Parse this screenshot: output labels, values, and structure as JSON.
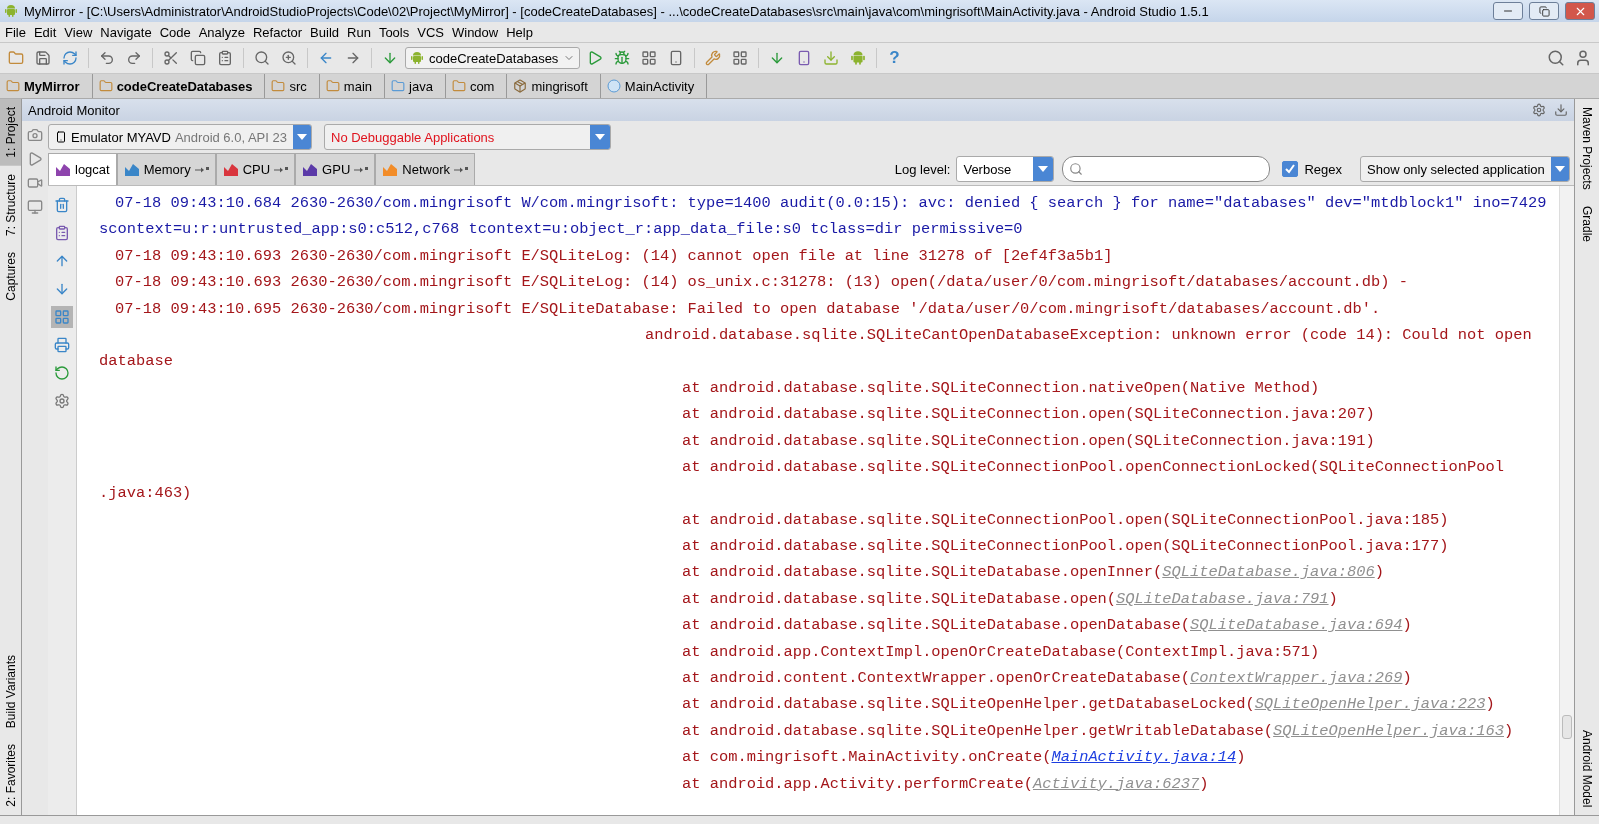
{
  "window": {
    "title": "MyMirror - [C:\\Users\\Administrator\\AndroidStudioProjects\\Code\\02\\Project\\MyMirror] - [codeCreateDatabases] - ...\\codeCreateDatabases\\src\\main\\java\\com\\mingrisoft\\MainActivity.java - Android Studio 1.5.1"
  },
  "menu": [
    "File",
    "Edit",
    "View",
    "Navigate",
    "Code",
    "Analyze",
    "Refactor",
    "Build",
    "Run",
    "Tools",
    "VCS",
    "Window",
    "Help"
  ],
  "toolbar": {
    "run_config": "codeCreateDatabases",
    "help": "?"
  },
  "breadcrumbs": [
    {
      "label": "MyMirror",
      "kind": "module"
    },
    {
      "label": "codeCreateDatabases",
      "kind": "module"
    },
    {
      "label": "src",
      "kind": "folder"
    },
    {
      "label": "main",
      "kind": "folder"
    },
    {
      "label": "java",
      "kind": "source"
    },
    {
      "label": "com",
      "kind": "folder"
    },
    {
      "label": "mingrisoft",
      "kind": "package"
    },
    {
      "label": "MainActivity",
      "kind": "class"
    }
  ],
  "left_stripe": {
    "top": [
      {
        "label": "1: Project",
        "selected": true
      },
      {
        "label": "7: Structure",
        "selected": false
      },
      {
        "label": "Captures",
        "selected": false
      }
    ],
    "bottom": [
      {
        "label": "Build Variants",
        "selected": false
      },
      {
        "label": "2: Favorites",
        "selected": false
      }
    ]
  },
  "right_stripe": {
    "top": [
      "Maven Projects",
      "Gradle"
    ],
    "bottom": [
      "Android Model"
    ]
  },
  "monitor": {
    "title": "Android Monitor",
    "device": {
      "name": "Emulator MYAVD",
      "detail": "Android 6.0, API 23"
    },
    "app": "No Debuggable Applications",
    "tabs": [
      {
        "label": "logcat",
        "selected": true
      },
      {
        "label": "Memory",
        "selected": false
      },
      {
        "label": "CPU",
        "selected": false
      },
      {
        "label": "GPU",
        "selected": false
      },
      {
        "label": "Network",
        "selected": false
      }
    ],
    "log_level_label": "Log level:",
    "log_level": "Verbose",
    "regex": {
      "label": "Regex",
      "checked": true
    },
    "filter": "Show only selected application"
  },
  "log": [
    {
      "kind": "entry",
      "color": "#1a1aa6",
      "text": "07-18 09:43:10.684 2630-2630/com.mingrisoft W/com.mingrisoft: type=1400 audit(0.0:15): avc: denied { search } for name=\"databases\" dev=\"mtdblock1\" ino=7429"
    },
    {
      "kind": "wrap",
      "color": "#1a1aa6",
      "text": "scontext=u:r:untrusted_app:s0:c512,c768 tcontext=u:object_r:app_data_file:s0 tclass=dir permissive=0"
    },
    {
      "kind": "entry",
      "color": "#a4161a",
      "text": "07-18 09:43:10.693 2630-2630/com.mingrisoft E/SQLiteLog: (14) cannot open file at line 31278 of [2ef4f3a5b1]"
    },
    {
      "kind": "entry",
      "color": "#a4161a",
      "text": "07-18 09:43:10.693 2630-2630/com.mingrisoft E/SQLiteLog: (14) os_unix.c:31278: (13) open(/data/user/0/com.mingrisoft/databases/account.db) -"
    },
    {
      "kind": "entry",
      "color": "#a4161a",
      "text": "07-18 09:43:10.695 2630-2630/com.mingrisoft E/SQLiteDatabase: Failed to open database '/data/user/0/com.mingrisoft/databases/account.db'."
    },
    {
      "kind": "message",
      "color": "#a4161a",
      "text": "android.database.sqlite.SQLiteCantOpenDatabaseException: unknown error (code 14): Could not open"
    },
    {
      "kind": "wrap",
      "color": "#a4161a",
      "text": "database"
    },
    {
      "kind": "frame",
      "color": "#a4161a",
      "text": "at android.database.sqlite.SQLiteConnection.nativeOpen(Native Method)"
    },
    {
      "kind": "frame",
      "color": "#a4161a",
      "text": "at android.database.sqlite.SQLiteConnection.open(SQLiteConnection.java:207)"
    },
    {
      "kind": "frame",
      "color": "#a4161a",
      "text": "at android.database.sqlite.SQLiteConnection.open(SQLiteConnection.java:191)"
    },
    {
      "kind": "frame",
      "color": "#a4161a",
      "text": "at android.database.sqlite.SQLiteConnectionPool.openConnectionLocked(SQLiteConnectionPool"
    },
    {
      "kind": "wrap",
      "color": "#a4161a",
      "text": ".java:463)"
    },
    {
      "kind": "frame",
      "color": "#a4161a",
      "text": "at android.database.sqlite.SQLiteConnectionPool.open(SQLiteConnectionPool.java:185)"
    },
    {
      "kind": "frame",
      "color": "#a4161a",
      "text": "at android.database.sqlite.SQLiteConnectionPool.open(SQLiteConnectionPool.java:177)"
    },
    {
      "kind": "frame",
      "color": "#a4161a",
      "text": "at android.database.sqlite.SQLiteDatabase.openInner(",
      "link": {
        "text": "SQLiteDatabase.java:806",
        "kind": "library"
      },
      "after": ")"
    },
    {
      "kind": "frame",
      "color": "#a4161a",
      "text": "at android.database.sqlite.SQLiteDatabase.open(",
      "link": {
        "text": "SQLiteDatabase.java:791",
        "kind": "library"
      },
      "after": ")"
    },
    {
      "kind": "frame",
      "color": "#a4161a",
      "text": "at android.database.sqlite.SQLiteDatabase.openDatabase(",
      "link": {
        "text": "SQLiteDatabase.java:694",
        "kind": "library"
      },
      "after": ")"
    },
    {
      "kind": "frame",
      "color": "#a4161a",
      "text": "at android.app.ContextImpl.openOrCreateDatabase(ContextImpl.java:571)"
    },
    {
      "kind": "frame",
      "color": "#a4161a",
      "text": "at android.content.ContextWrapper.openOrCreateDatabase(",
      "link": {
        "text": "ContextWrapper.java:269",
        "kind": "library"
      },
      "after": ")"
    },
    {
      "kind": "frame",
      "color": "#a4161a",
      "text": "at android.database.sqlite.SQLiteOpenHelper.getDatabaseLocked(",
      "link": {
        "text": "SQLiteOpenHelper.java:223",
        "kind": "library"
      },
      "after": ")"
    },
    {
      "kind": "frame",
      "color": "#a4161a",
      "text": "at android.database.sqlite.SQLiteOpenHelper.getWritableDatabase(",
      "link": {
        "text": "SQLiteOpenHelper.java:163",
        "kind": "library"
      },
      "after": ")"
    },
    {
      "kind": "frame",
      "color": "#a4161a",
      "text": "at com.mingrisoft.MainActivity.onCreate(",
      "link": {
        "text": "MainActivity.java:14",
        "kind": "project"
      },
      "after": ")"
    },
    {
      "kind": "frame",
      "color": "#a4161a",
      "text": "at android.app.Activity.performCreate(",
      "link": {
        "text": "Activity.java:6237",
        "kind": "library"
      },
      "after": ")"
    }
  ]
}
